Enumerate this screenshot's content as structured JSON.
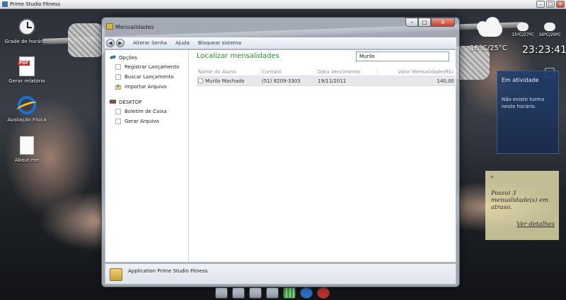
{
  "top_window": {
    "title": "Prime Studio Fitness"
  },
  "desktop_icons": [
    {
      "label": "Grade de horários"
    },
    {
      "label": "Gerar relatório"
    },
    {
      "label": "Avaliação Física"
    },
    {
      "label": "About me"
    }
  ],
  "weather": {
    "main_temp": "16°C/25°C",
    "small1": "15ºC/27ºC",
    "small2": "16ºC/29ºC",
    "time": "23:23:41"
  },
  "activity": {
    "title": "Em atividade",
    "text": "Não existe turma neste horário."
  },
  "sticky": {
    "text": "Possui 3 mensalidade(s) em atraso.",
    "link": "Ver detalhes"
  },
  "window": {
    "title": "Mensalidades",
    "menu": [
      "Alterar Senha",
      "Ajuda",
      "Bloquear sistema"
    ]
  },
  "sidebar": {
    "groups": [
      {
        "label": "Opções",
        "items": [
          "Registrar Lançamento",
          "Buscar Lançamento",
          "Importar Arquivo"
        ]
      },
      {
        "label": "DESKTOP",
        "items": [
          "Boletim de Caixa",
          "Gerar Arquivo"
        ]
      }
    ]
  },
  "main": {
    "title": "Localizar mensalidades",
    "search_value": "Murilo",
    "columns": [
      "Nome do Aluno",
      "Contato",
      "Data Vencimento",
      "Valor Mensalidade(R$)"
    ],
    "rows": [
      [
        "Murilo Machado",
        "(51) 8209-3303",
        "19/11/2011",
        "140,00"
      ]
    ]
  },
  "status": {
    "text": "Application Prime Studio Fitness"
  },
  "colors": {
    "title_green": "#2f8a2f",
    "menu_blue": "#223a66"
  }
}
